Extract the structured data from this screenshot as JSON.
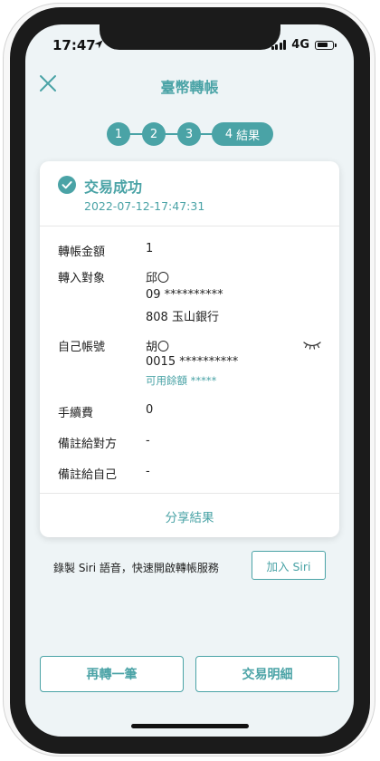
{
  "status_bar": {
    "time": "17:47",
    "network": "4G"
  },
  "nav": {
    "title": "臺幣轉帳"
  },
  "steps": {
    "s1": "1",
    "s2": "2",
    "s3": "3",
    "s4_num": "4",
    "s4_label": "結果"
  },
  "result": {
    "title": "交易成功",
    "timestamp": "2022-07-12-17:47:31",
    "rows": {
      "amount_label": "轉帳金額",
      "amount_value": "1",
      "payee_label": "轉入對象",
      "payee_name": "邱〇",
      "payee_account": "09 **********",
      "payee_bank": "808 玉山銀行",
      "own_label": "自己帳號",
      "own_name": "胡〇",
      "own_account": "0015 **********",
      "own_balance": "可用餘額 *****",
      "fee_label": "手續費",
      "fee_value": "0",
      "note_payee_label": "備註給對方",
      "note_payee_value": "-",
      "note_self_label": "備註給自己",
      "note_self_value": "-"
    },
    "share_label": "分享結果"
  },
  "siri": {
    "text": "錄製 Siri 語音，快速開啟轉帳服務",
    "button": "加入 Siri"
  },
  "actions": {
    "again": "再轉一筆",
    "details": "交易明細"
  },
  "theme": {
    "accent": "#4aa3a6",
    "background": "#eef4f6"
  }
}
